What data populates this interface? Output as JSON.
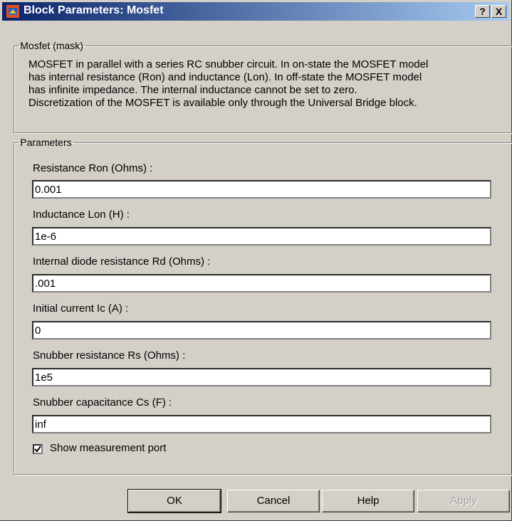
{
  "window": {
    "title": "Block Parameters: Mosfet",
    "help_btn": "?",
    "close_btn": "X"
  },
  "mask": {
    "legend": "Mosfet (mask)",
    "description_lines": [
      "MOSFET in parallel with a series RC snubber circuit. In on-state the MOSFET model",
      "has internal resistance (Ron) and inductance (Lon). In off-state the MOSFET model",
      "has infinite impedance. The internal inductance cannot be set to zero.",
      "Discretization of the MOSFET is available only through the Universal Bridge block."
    ]
  },
  "parameters": {
    "legend": "Parameters",
    "fields": [
      {
        "label": "Resistance Ron (Ohms) :",
        "value": "0.001"
      },
      {
        "label": "Inductance Lon (H) :",
        "value": "1e-6"
      },
      {
        "label": "Internal diode resistance Rd  (Ohms) :",
        "value": ".001"
      },
      {
        "label": "Initial current Ic (A) :",
        "value": "0"
      },
      {
        "label": "Snubber resistance Rs (Ohms) :",
        "value": "1e5"
      },
      {
        "label": "Snubber capacitance Cs (F) :",
        "value": "inf"
      }
    ],
    "show_port": {
      "label": "Show measurement port",
      "checked": true
    }
  },
  "buttons": {
    "ok": "OK",
    "cancel": "Cancel",
    "help": "Help",
    "apply": "Apply"
  }
}
